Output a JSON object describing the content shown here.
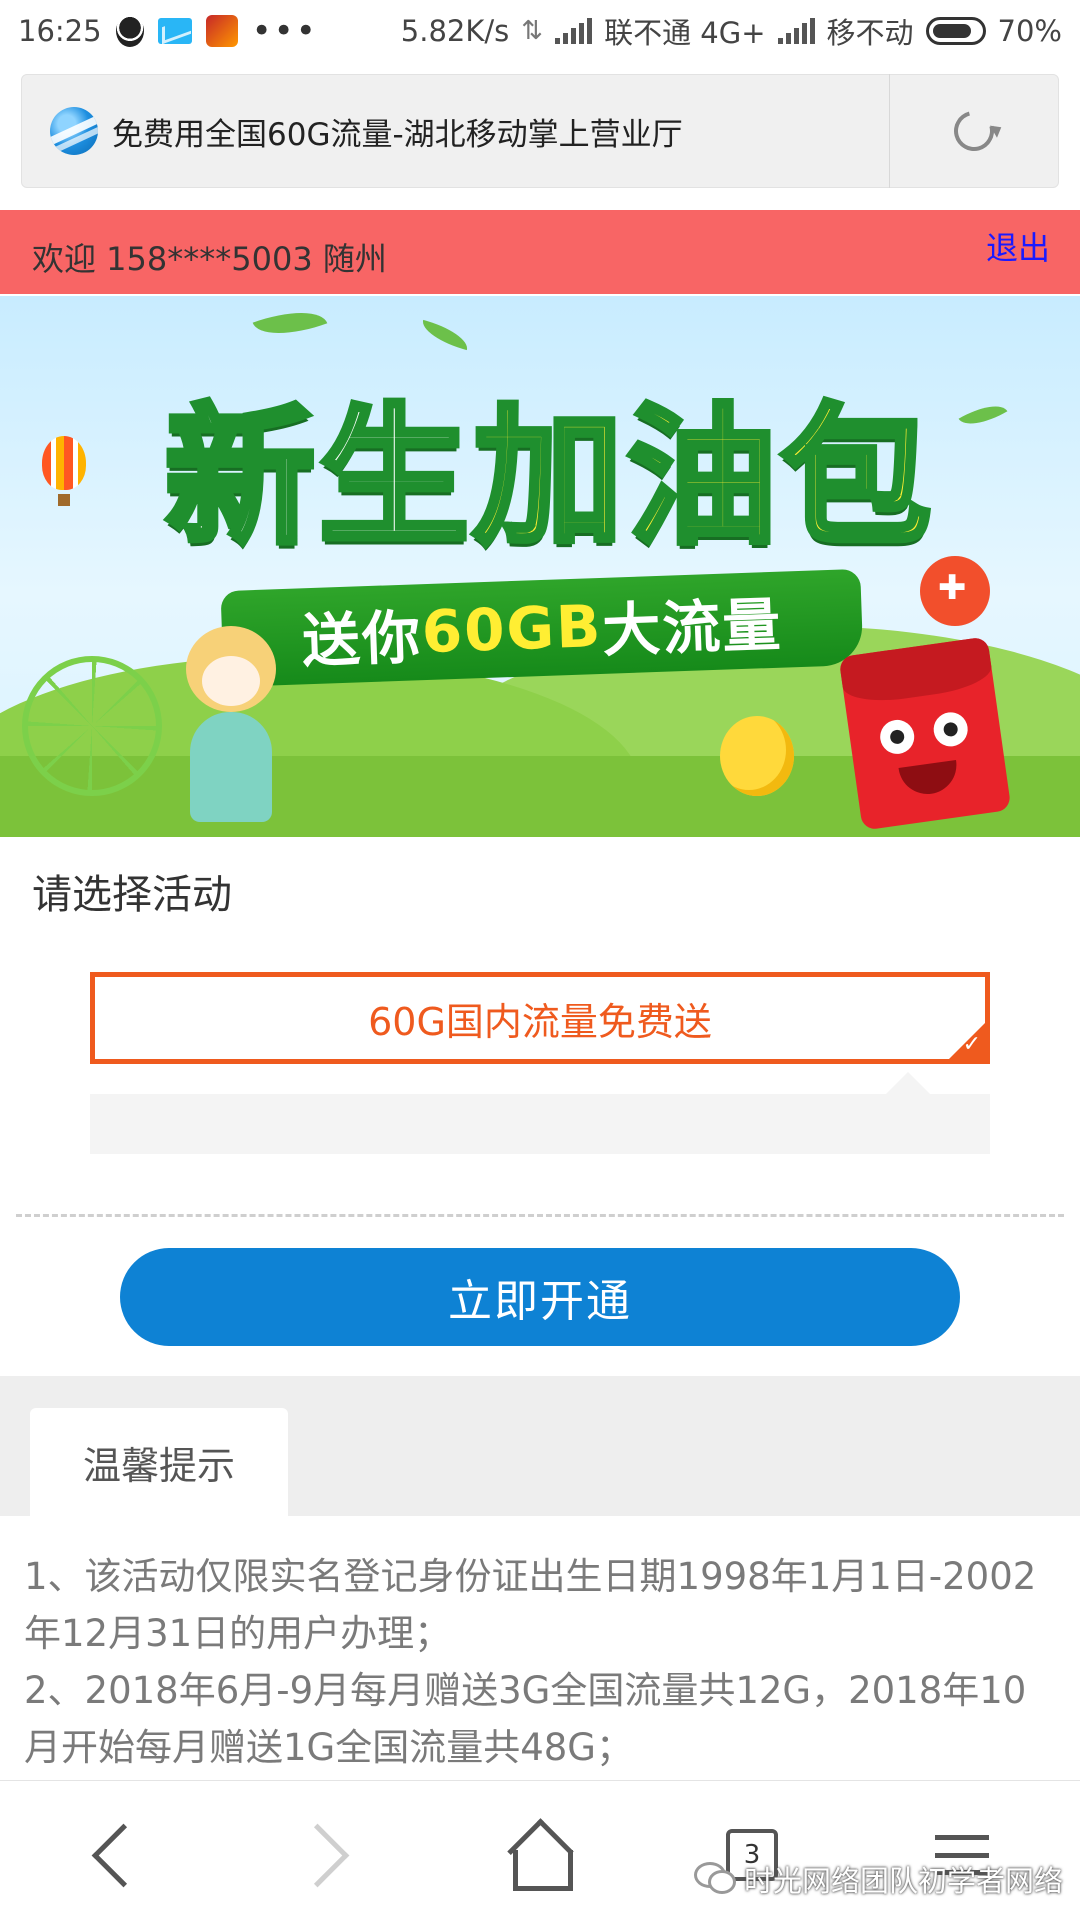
{
  "status_bar": {
    "time": "16:25",
    "dots": "•••",
    "speed": "5.82K/s",
    "updown": "⇅",
    "carrier1": "联不通 4G+",
    "carrier2": "移不动",
    "battery": "70%"
  },
  "browser": {
    "page_title": "免费用全国60G流量-湖北移动掌上营业厅",
    "tabs_count": "3"
  },
  "header": {
    "welcome": "欢迎 158****5003 随州",
    "logout": "退出"
  },
  "banner": {
    "title_part1": "新生",
    "title_part2": "加油包",
    "ribbon_part1": "送你",
    "ribbon_part2": "60GB",
    "ribbon_part3": "大流量"
  },
  "activity": {
    "section_title": "请选择活动",
    "selected_option": "60G国内流量免费送",
    "submit_label": "立即开通"
  },
  "tips": {
    "tab_label": "温馨提示",
    "line1": "1、该活动仅限实名登记身份证出生日期1998年1月1日-2002年12月31日的用户办理；",
    "line2": "2、2018年6月-9月每月赠送3G全国流量共12G，2018年10月开始每月赠送1G全国流量共48G；"
  },
  "watermark": "时光网络团队初学者网络",
  "colors": {
    "welcome_bg": "#f86565",
    "accent_orange": "#ef5a1e",
    "button_blue": "#0e82d4",
    "logout_link": "#1a1aff"
  }
}
